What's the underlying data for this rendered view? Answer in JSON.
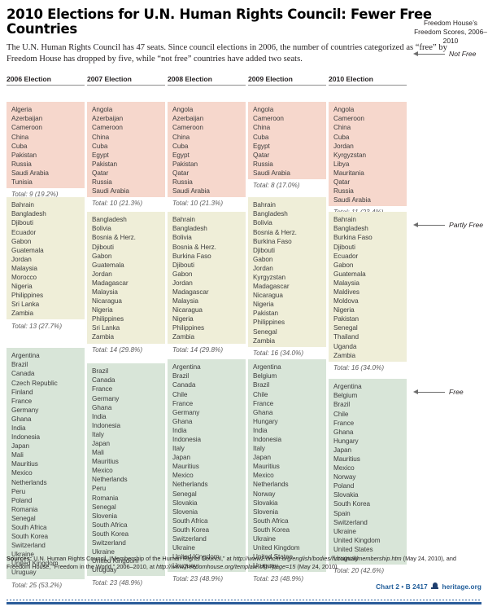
{
  "header": {
    "title": "2010 Elections for U.N. Human Rights Council: Fewer Free Countries",
    "subtitle": "The U.N. Human Rights Council has 47 seats. Since council elections in 2006, the number of countries categorized as “free” by Freedom House has dropped by five, while “not free” countries have added two seats."
  },
  "legend": {
    "title": "Freedom House’s Freedom Scores, 2006–2010",
    "not_free": "Not Free",
    "partly_free": "Partly Free",
    "free": "Free",
    "colors": {
      "not_free": "#f6d7cc",
      "partly_free": "#efeed8",
      "free": "#d8e5d8"
    }
  },
  "chart_data": {
    "type": "table",
    "title": "2010 Elections for U.N. Human Rights Council: Fewer Free Countries",
    "categories": [
      "2006 Election",
      "2007 Election",
      "2008 Election",
      "2009 Election",
      "2010 Election"
    ],
    "series": [
      {
        "name": "Not Free",
        "values": [
          9,
          10,
          10,
          8,
          11
        ],
        "percents": [
          "19.2%",
          "21.3%",
          "21.3%",
          "17.0%",
          "23.4%"
        ]
      },
      {
        "name": "Partly Free",
        "values": [
          13,
          14,
          14,
          16,
          16
        ],
        "percents": [
          "27.7%",
          "29.8%",
          "29.8%",
          "34.0%",
          "34.0%"
        ]
      },
      {
        "name": "Free",
        "values": [
          25,
          23,
          23,
          23,
          20
        ],
        "percents": [
          "53.2%",
          "48.9%",
          "48.9%",
          "48.9%",
          "42.6%"
        ]
      }
    ],
    "total_seats": 47
  },
  "columns": [
    {
      "header": "2006 Election",
      "not_free": {
        "countries": [
          "Algeria",
          "Azerbaijan",
          "Cameroon",
          "China",
          "Cuba",
          "Pakistan",
          "Russia",
          "Saudi Arabia",
          "Tunisia"
        ],
        "total": "Total: 9 (19.2%)"
      },
      "partly_free": {
        "countries": [
          "Bahrain",
          "Bangladesh",
          "Djibouti",
          "Ecuador",
          "Gabon",
          "Guatemala",
          "Jordan",
          "Malaysia",
          "Morocco",
          "Nigeria",
          "Philippines",
          "Sri Lanka",
          "Zambia"
        ],
        "total": "Total: 13 (27.7%)"
      },
      "free": {
        "countries": [
          "Argentina",
          "Brazil",
          "Canada",
          "Czech Republic",
          "Finland",
          "France",
          "Germany",
          "Ghana",
          "India",
          "Indonesia",
          "Japan",
          "Mali",
          "Mauritius",
          "Mexico",
          "Netherlands",
          "Peru",
          "Poland",
          "Romania",
          "Senegal",
          "South Africa",
          "South Korea",
          "Switzerland",
          "Ukraine",
          "United Kingdom",
          "Uruguay"
        ],
        "total": "Total: 25 (53.2%)"
      }
    },
    {
      "header": "2007 Election",
      "not_free": {
        "countries": [
          "Angola",
          "Azerbaijan",
          "Cameroon",
          "China",
          "Cuba",
          "Egypt",
          "Pakistan",
          "Qatar",
          "Russia",
          "Saudi Arabia"
        ],
        "total": "Total: 10 (21.3%)"
      },
      "partly_free": {
        "countries": [
          "Bangladesh",
          "Bolivia",
          "Bosnia & Herz.",
          "Djibouti",
          "Gabon",
          "Guatemala",
          "Jordan",
          "Madagascar",
          "Malaysia",
          "Nicaragua",
          "Nigeria",
          "Philippines",
          "Sri Lanka",
          "Zambia"
        ],
        "total": "Total: 14 (29.8%)"
      },
      "free": {
        "countries": [
          "Brazil",
          "Canada",
          "France",
          "Germany",
          "Ghana",
          "India",
          "Indonesia",
          "Italy",
          "Japan",
          "Mali",
          "Mauritius",
          "Mexico",
          "Netherlands",
          "Peru",
          "Romania",
          "Senegal",
          "Slovenia",
          "South Africa",
          "South Korea",
          "Switzerland",
          "Ukraine",
          "United Kingdom",
          "Uruguay"
        ],
        "total": "Total: 23 (48.9%)"
      }
    },
    {
      "header": "2008 Election",
      "not_free": {
        "countries": [
          "Angola",
          "Azerbaijan",
          "Cameroon",
          "China",
          "Cuba",
          "Egypt",
          "Pakistan",
          "Qatar",
          "Russia",
          "Saudi Arabia"
        ],
        "total": "Total: 10 (21.3%)"
      },
      "partly_free": {
        "countries": [
          "Bahrain",
          "Bangladesh",
          "Bolivia",
          "Bosnia & Herz.",
          "Burkina Faso",
          "Djibouti",
          "Gabon",
          "Jordan",
          "Madagascar",
          "Malaysia",
          "Nicaragua",
          "Nigeria",
          "Philippines",
          "Zambia"
        ],
        "total": "Total: 14 (29.8%)"
      },
      "free": {
        "countries": [
          "Argentina",
          "Brazil",
          "Canada",
          "Chile",
          "France",
          "Germany",
          "Ghana",
          "India",
          "Indonesia",
          "Italy",
          "Japan",
          "Mauritius",
          "Mexico",
          "Netherlands",
          "Senegal",
          "Slovakia",
          "Slovenia",
          "South Africa",
          "South Korea",
          "Switzerland",
          "Ukraine",
          "United Kingdom",
          "Uruguay"
        ],
        "total": "Total: 23 (48.9%)"
      }
    },
    {
      "header": "2009 Election",
      "not_free": {
        "countries": [
          "Angola",
          "Cameroon",
          "China",
          "Cuba",
          "Egypt",
          "Qatar",
          "Russia",
          "Saudi Arabia"
        ],
        "total": "Total: 8 (17.0%)"
      },
      "partly_free": {
        "countries": [
          "Bahrain",
          "Bangladesh",
          "Bolivia",
          "Bosnia & Herz.",
          "Burkina Faso",
          "Djibouti",
          "Gabon",
          "Jordan",
          "Kyrgyzstan",
          "Madagascar",
          "Nicaragua",
          "Nigeria",
          "Pakistan",
          "Philippines",
          "Senegal",
          "Zambia"
        ],
        "total": "Total: 16 (34.0%)"
      },
      "free": {
        "countries": [
          "Argentina",
          "Belgium",
          "Brazil",
          "Chile",
          "France",
          "Ghana",
          "Hungary",
          "India",
          "Indonesia",
          "Italy",
          "Japan",
          "Mauritius",
          "Mexico",
          "Netherlands",
          "Norway",
          "Slovakia",
          "Slovenia",
          "South Africa",
          "South Korea",
          "Ukraine",
          "United Kingdom",
          "United States",
          "Uruguay"
        ],
        "total": "Total: 23 (48.9%)"
      }
    },
    {
      "header": "2010 Election",
      "not_free": {
        "countries": [
          "Angola",
          "Cameroon",
          "China",
          "Cuba",
          "Jordan",
          "Kyrgyzstan",
          "Libya",
          "Mauritania",
          "Qatar",
          "Russia",
          "Saudi Arabia"
        ],
        "total": "Total: 11 (23.4%)"
      },
      "partly_free": {
        "countries": [
          "Bahrain",
          "Bangladesh",
          "Burkina Faso",
          "Djibouti",
          "Ecuador",
          "Gabon",
          "Guatemala",
          "Malaysia",
          "Maldives",
          "Moldova",
          "Nigeria",
          "Pakistan",
          "Senegal",
          "Thailand",
          "Uganda",
          "Zambia"
        ],
        "total": "Total: 16 (34.0%)"
      },
      "free": {
        "countries": [
          "Argentina",
          "Belgium",
          "Brazil",
          "Chile",
          "France",
          "Ghana",
          "Hungary",
          "Japan",
          "Mauritius",
          "Mexico",
          "Norway",
          "Poland",
          "Slovakia",
          "South Korea",
          "Spain",
          "Switzerland",
          "Ukraine",
          "United Kingdom",
          "United States",
          "Uruguay"
        ],
        "total": "Total: 20 (42.6%)"
      }
    }
  ],
  "footer": {
    "sources_label": "Sources:",
    "sources_text_1": " U.N. Human Rights Council, “Membership of the Human Rights Council,” at ",
    "sources_url_1": "http://www2.ohchr.org/english/bodies/hrcouncil/membership.htm",
    "sources_text_2": " (May 24, 2010), and Freedom House, “Freedom in the World,” 2006–2010, at ",
    "sources_url_2": "http://www.freedomhouse.org/template.cfm?page=15",
    "sources_text_3": " (May 24, 2010).",
    "chart_id": "Chart 2 • B 2417",
    "site": "heritage.org"
  }
}
